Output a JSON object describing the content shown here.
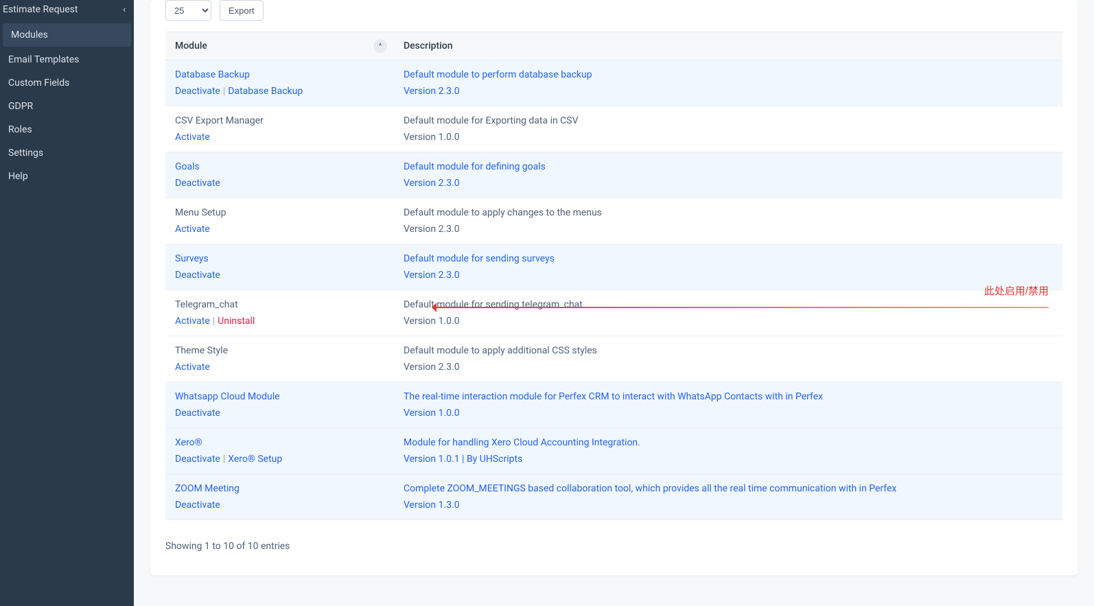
{
  "sidebar": {
    "parent": {
      "label": "Estimate Request"
    },
    "items": [
      {
        "label": "Modules",
        "active": true
      },
      {
        "label": "Email Templates"
      },
      {
        "label": "Custom Fields"
      },
      {
        "label": "GDPR"
      },
      {
        "label": "Roles"
      },
      {
        "label": "Settings"
      },
      {
        "label": "Help"
      }
    ]
  },
  "toolbar": {
    "page_size": "25",
    "export_label": "Export"
  },
  "table": {
    "headers": {
      "module": "Module",
      "description": "Description"
    },
    "rows": [
      {
        "hl": true,
        "name": "Database Backup",
        "name_link": true,
        "actions": [
          {
            "label": "Deactivate",
            "style": "link"
          },
          {
            "label": "Database Backup",
            "style": "link"
          }
        ],
        "desc": "Default module to perform database backup",
        "desc_link": true,
        "version": "Version 2.3.0",
        "version_link": true
      },
      {
        "hl": false,
        "name": "CSV Export Manager",
        "name_link": false,
        "actions": [
          {
            "label": "Activate",
            "style": "link"
          }
        ],
        "desc": "Default module for Exporting data in CSV",
        "desc_link": false,
        "version": "Version 1.0.0",
        "version_link": false
      },
      {
        "hl": true,
        "name": "Goals",
        "name_link": true,
        "actions": [
          {
            "label": "Deactivate",
            "style": "link"
          }
        ],
        "desc": "Default module for defining goals",
        "desc_link": true,
        "version": "Version 2.3.0",
        "version_link": true
      },
      {
        "hl": false,
        "name": "Menu Setup",
        "name_link": false,
        "actions": [
          {
            "label": "Activate",
            "style": "link"
          }
        ],
        "desc": "Default module to apply changes to the menus",
        "desc_link": false,
        "version": "Version 2.3.0",
        "version_link": false
      },
      {
        "hl": true,
        "name": "Surveys",
        "name_link": true,
        "actions": [
          {
            "label": "Deactivate",
            "style": "link"
          }
        ],
        "desc": "Default module for sending surveys",
        "desc_link": true,
        "version": "Version 2.3.0",
        "version_link": true
      },
      {
        "hl": false,
        "name": "Telegram_chat",
        "name_link": false,
        "actions": [
          {
            "label": "Activate",
            "style": "link"
          },
          {
            "label": "Uninstall",
            "style": "danger"
          }
        ],
        "desc": "Default module for sending telegram_chat",
        "desc_link": false,
        "version": "Version 1.0.0",
        "version_link": false,
        "tip": "此处启用/禁用",
        "arrow": true
      },
      {
        "hl": false,
        "name": "Theme Style",
        "name_link": false,
        "actions": [
          {
            "label": "Activate",
            "style": "link"
          }
        ],
        "desc": "Default module to apply additional CSS styles",
        "desc_link": false,
        "version": "Version 2.3.0",
        "version_link": false
      },
      {
        "hl": true,
        "name": "Whatsapp Cloud Module",
        "name_link": true,
        "actions": [
          {
            "label": "Deactivate",
            "style": "link"
          }
        ],
        "desc": "The real-time interaction module for Perfex CRM to interact with WhatsApp Contacts with in Perfex",
        "desc_link": true,
        "version": "Version 1.0.0",
        "version_link": true
      },
      {
        "hl": true,
        "name": "Xero®",
        "name_link": true,
        "actions": [
          {
            "label": "Deactivate",
            "style": "link"
          },
          {
            "label": "Xero® Setup",
            "style": "link"
          }
        ],
        "desc": "Module for handling Xero Cloud Accounting Integration.",
        "desc_link": true,
        "version": "Version 1.0.1 | By UHScripts",
        "version_link": true
      },
      {
        "hl": true,
        "name": "ZOOM Meeting",
        "name_link": true,
        "actions": [
          {
            "label": "Deactivate",
            "style": "link"
          }
        ],
        "desc": "Complete ZOOM_MEETINGS based collaboration tool, which provides all the real time communication with in Perfex",
        "desc_link": true,
        "version": "Version 1.3.0",
        "version_link": true
      }
    ]
  },
  "footer": {
    "text": "Showing 1 to 10 of 10 entries"
  }
}
